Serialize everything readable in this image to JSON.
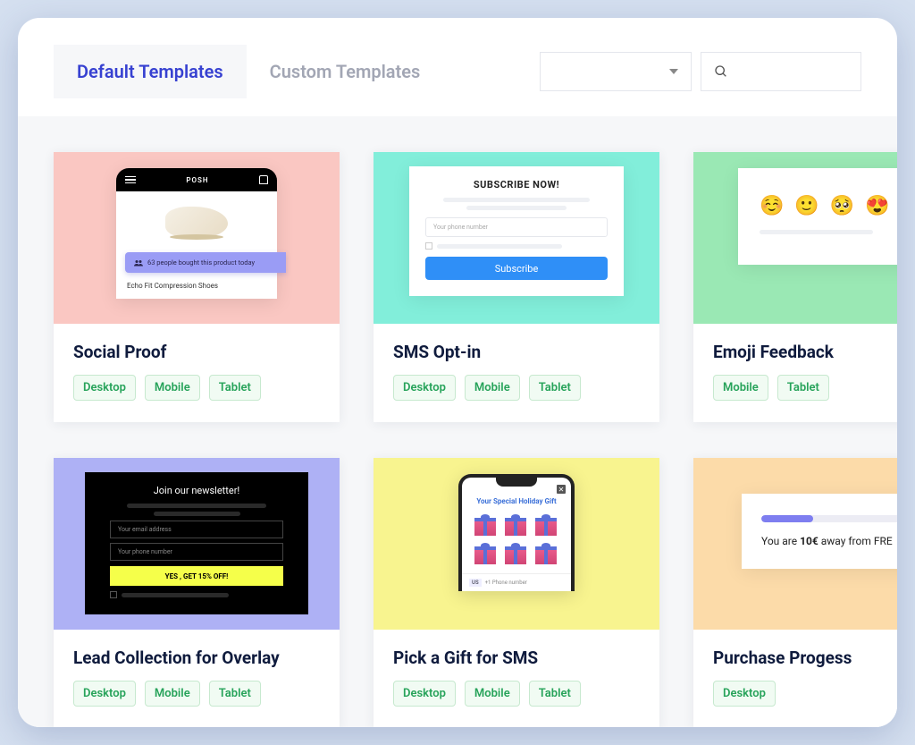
{
  "tabs": {
    "default": "Default Templates",
    "custom": "Custom Templates"
  },
  "cards": [
    {
      "title": "Social Proof",
      "tags": [
        "Desktop",
        "Mobile",
        "Tablet"
      ],
      "preview": {
        "brand": "POSH",
        "proof_text": "63 people bought this product today",
        "caption": "Echo Fit Compression Shoes"
      }
    },
    {
      "title": "SMS Opt-in",
      "tags": [
        "Desktop",
        "Mobile",
        "Tablet"
      ],
      "preview": {
        "heading": "SUBSCRIBE NOW!",
        "placeholder": "Your phone number",
        "button": "Subscribe"
      }
    },
    {
      "title": "Emoji Feedback",
      "tags": [
        "Mobile",
        "Tablet"
      ],
      "preview": {
        "emojis": [
          "☺️",
          "🙂",
          "🥺",
          "😍"
        ]
      }
    },
    {
      "title": "Lead Collection for Overlay",
      "tags": [
        "Desktop",
        "Mobile",
        "Tablet"
      ],
      "preview": {
        "heading": "Join our newsletter!",
        "placeholder1": "Your email address",
        "placeholder2": "Your phone number",
        "cta": "YES , GET 15% OFF!"
      }
    },
    {
      "title": "Pick a Gift for SMS",
      "tags": [
        "Desktop",
        "Mobile",
        "Tablet"
      ],
      "preview": {
        "heading": "Your Special Holiday Gift",
        "footer_tag": "US",
        "footer_placeholder": "+1 Phone number"
      }
    },
    {
      "title": "Purchase Progess",
      "tags": [
        "Desktop"
      ],
      "preview": {
        "text_before": "You are ",
        "amount": "10€",
        "text_after": " away from FRE"
      }
    }
  ]
}
